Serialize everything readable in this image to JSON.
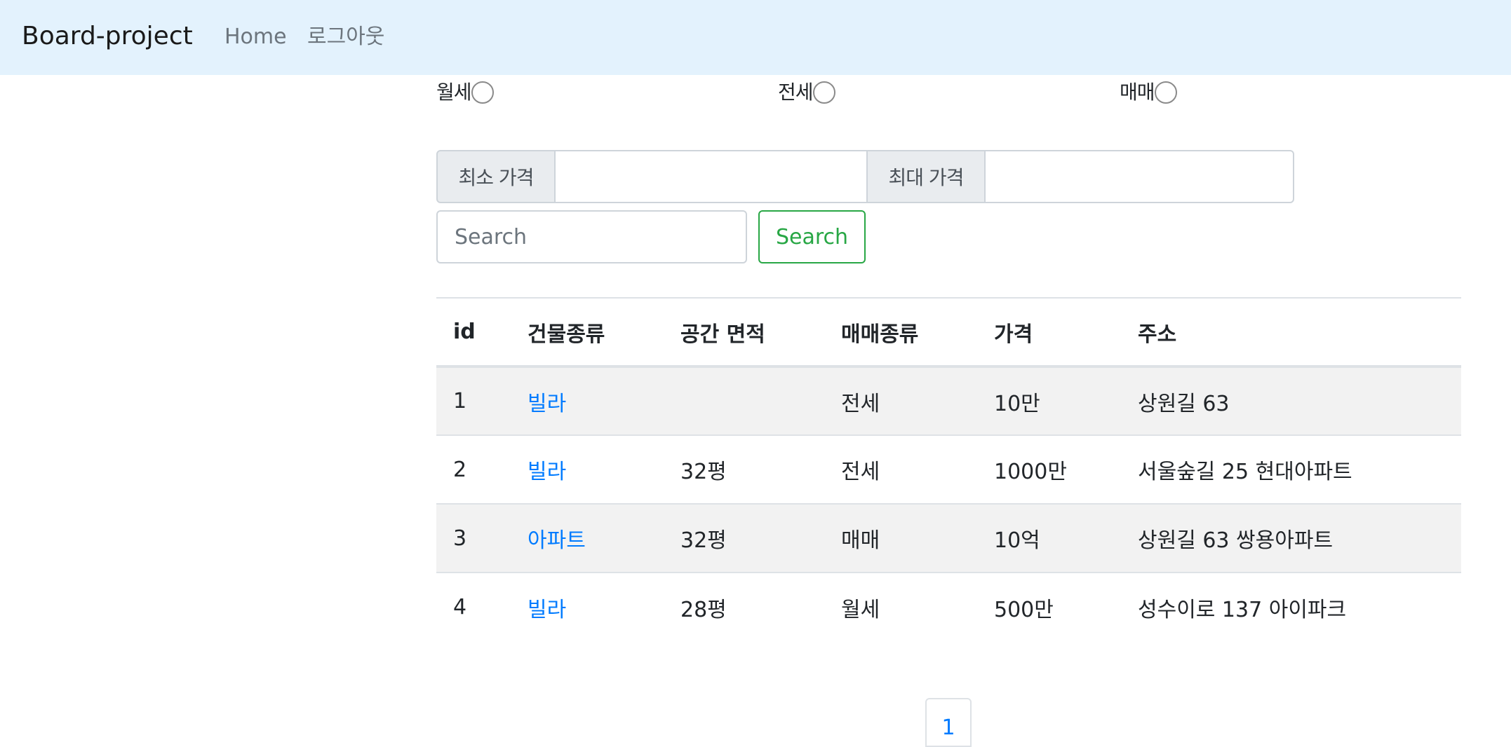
{
  "navbar": {
    "brand": "Board-project",
    "links": [
      "Home",
      "로그아웃"
    ]
  },
  "filters": {
    "radios": [
      "월세",
      "전세",
      "매매"
    ],
    "min_price_label": "최소 가격",
    "max_price_label": "최대 가격",
    "min_price_value": "",
    "max_price_value": "",
    "search_placeholder": "Search",
    "search_button": "Search"
  },
  "table": {
    "headers": [
      "id",
      "건물종류",
      "공간 면적",
      "매매종류",
      "가격",
      "주소"
    ],
    "rows": [
      [
        "1",
        "빌라",
        "",
        "전세",
        "10만",
        "상원길 63"
      ],
      [
        "2",
        "빌라",
        "32평",
        "전세",
        "1000만",
        "서울숲길 25 현대아파트"
      ],
      [
        "3",
        "아파트",
        "32평",
        "매매",
        "10억",
        "상원길 63 쌍용아파트"
      ],
      [
        "4",
        "빌라",
        "28평",
        "월세",
        "500만",
        "성수이로 137 아이파크"
      ]
    ]
  },
  "pagination": {
    "current": "1"
  },
  "colors": {
    "navbar_bg": "#e3f2fd",
    "link": "#007bff",
    "success": "#28a745",
    "stripe": "#f2f2f2"
  }
}
